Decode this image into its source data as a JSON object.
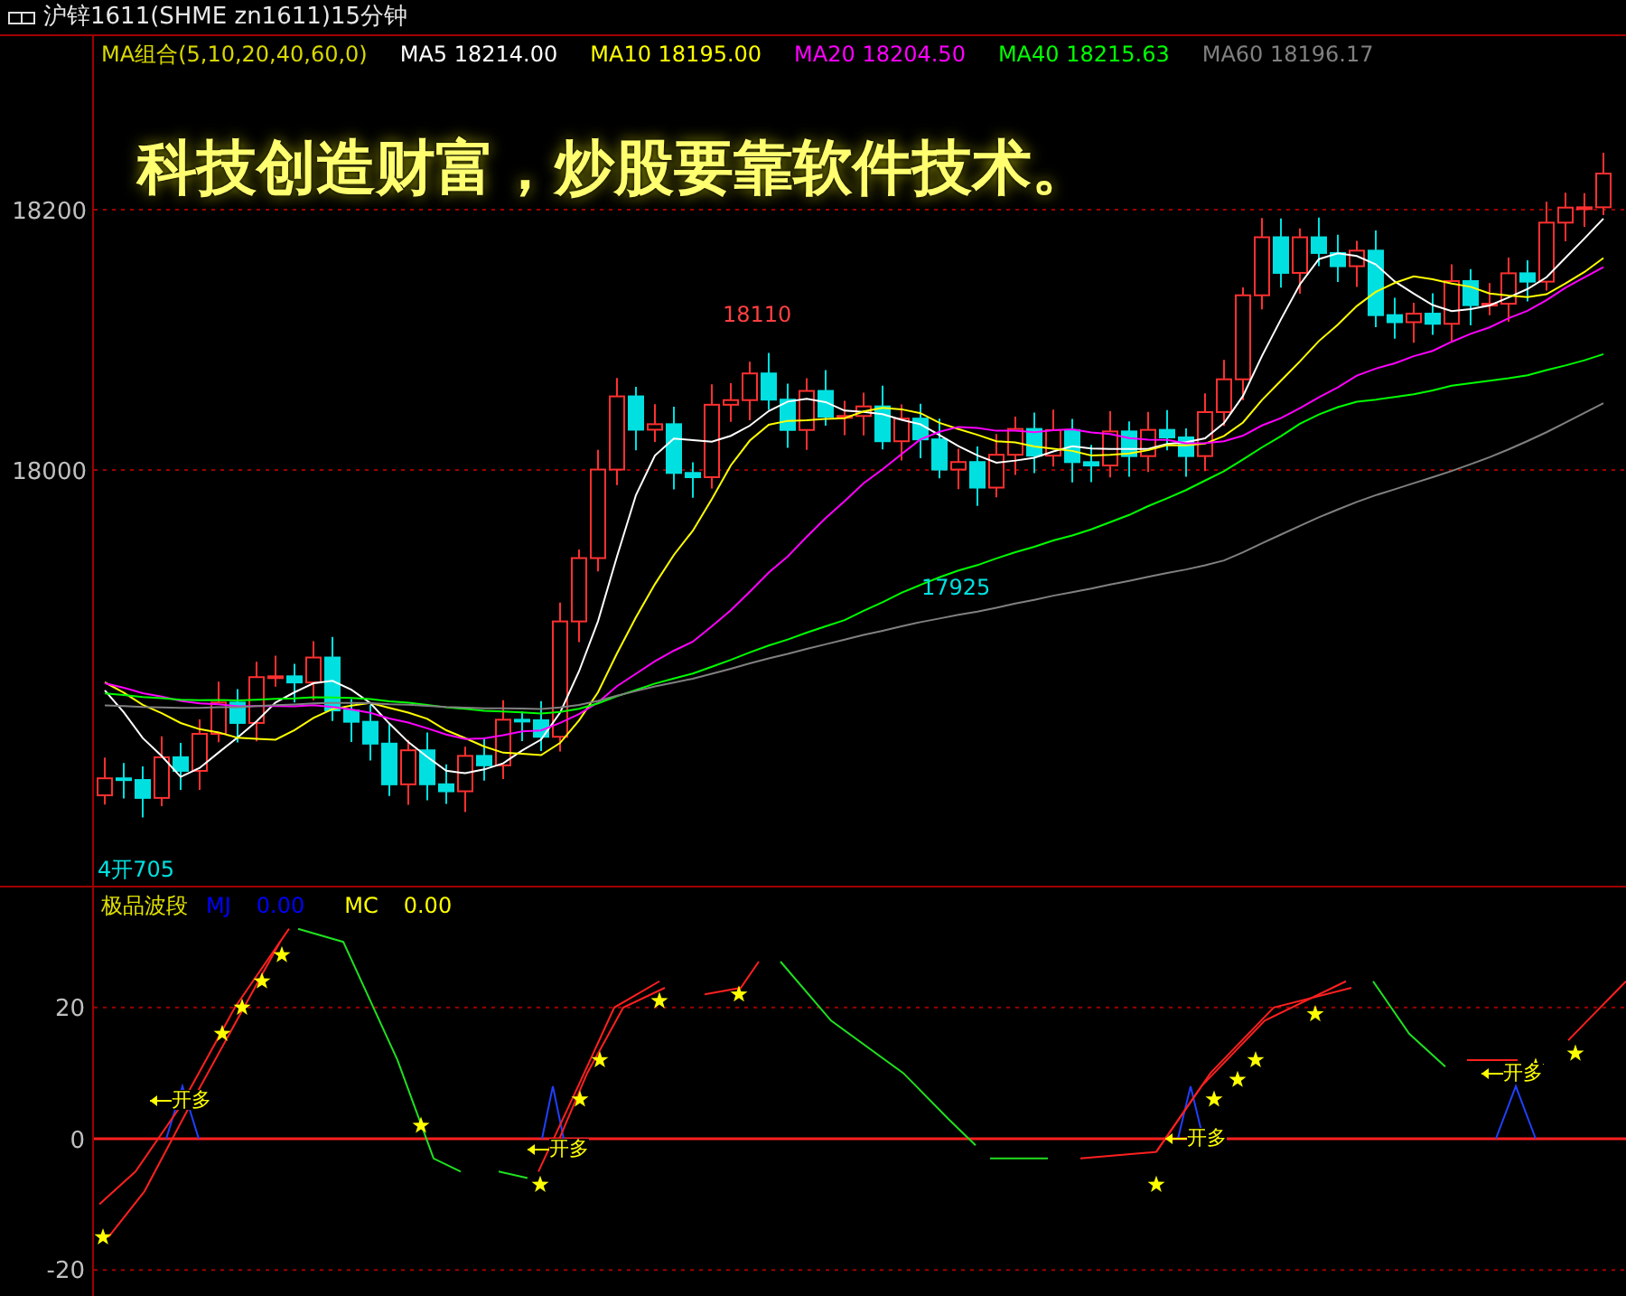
{
  "window": {
    "title": "沪锌1611(SHME zn1611)15分钟"
  },
  "main_chart": {
    "legend": [
      {
        "label": "MA组合(5,10,20,40,60,0)",
        "color": "#d8d800"
      },
      {
        "label": "MA5 18214.00",
        "color": "#ffffff"
      },
      {
        "label": "MA10 18195.00",
        "color": "#ffff00"
      },
      {
        "label": "MA20 18204.50",
        "color": "#ff00ff"
      },
      {
        "label": "MA40 18215.63",
        "color": "#00ff00"
      },
      {
        "label": "MA60 18196.17",
        "color": "#808080"
      }
    ],
    "y_ticks": [
      "18200",
      "18000"
    ],
    "annotations": [
      "18110",
      "17925",
      "4开705"
    ],
    "banner": "科技创造财富，炒股要靠软件技术。"
  },
  "indicator": {
    "title": "极品波段",
    "values": [
      {
        "label": "MJ",
        "value": "0.00",
        "color": "#0000ff"
      },
      {
        "label": "MC",
        "value": "0.00",
        "color": "#ffff00"
      }
    ],
    "y_ticks": [
      "20",
      "0",
      "-20"
    ],
    "signals": [
      "开多",
      "开多",
      "开多",
      "开多"
    ]
  }
}
